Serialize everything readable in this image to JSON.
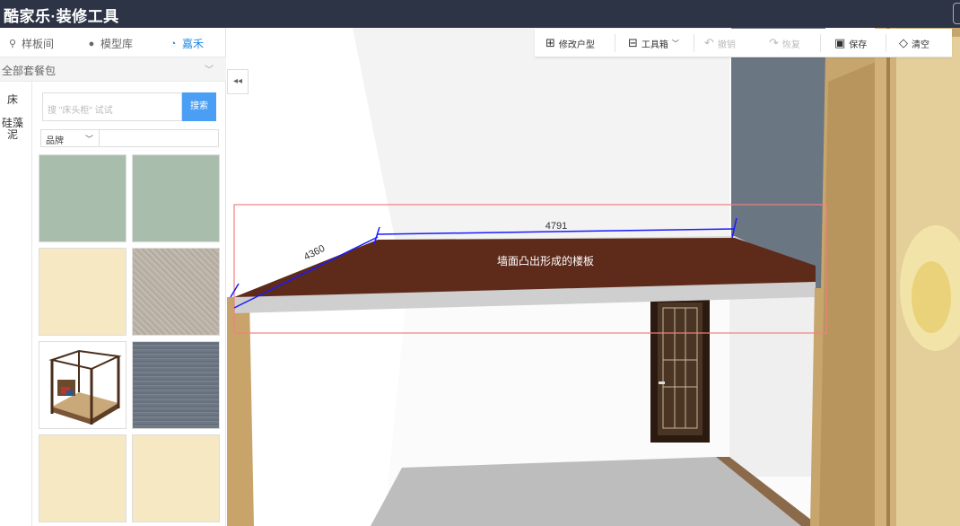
{
  "app": {
    "title": "酷家乐·装修工具"
  },
  "sidebar": {
    "tabs": [
      {
        "label": "样板间",
        "icon": "pin-icon"
      },
      {
        "label": "模型库",
        "icon": "cube-icon"
      },
      {
        "label": "嘉禾",
        "icon": "tag-icon",
        "active": true
      }
    ],
    "package_filter": {
      "value": "全部套餐包"
    },
    "categories": [
      "床",
      "硅藻泥"
    ],
    "search": {
      "placeholder": "搜 \"床头柜\" 试试",
      "button": "搜索"
    },
    "brand_filter": {
      "label": "品牌"
    },
    "products": [
      {
        "kind": "swatch",
        "color": "#a9bdad"
      },
      {
        "kind": "swatch",
        "color": "#a9bdad"
      },
      {
        "kind": "swatch",
        "color": "#f5e8c3"
      },
      {
        "kind": "texture",
        "color": "#b8b0a4"
      },
      {
        "kind": "bed-image"
      },
      {
        "kind": "texture",
        "color": "#6e7784"
      },
      {
        "kind": "swatch",
        "color": "#f5e8c3"
      },
      {
        "kind": "swatch",
        "color": "#f5e8c3"
      }
    ]
  },
  "toolbar": {
    "edit_floorplan": "修改户型",
    "toolbox": "工具箱",
    "undo": "撤销",
    "redo": "恢复",
    "save": "保存",
    "clear": "清空"
  },
  "scene": {
    "dimension_left": "4360",
    "dimension_top": "4791",
    "floor_label": "墙面凸出形成的楼板",
    "colors": {
      "slab": "#5e2a1a",
      "selection": "#f08080",
      "dimension": "#1a1aff",
      "wall_dark": "#6b7683",
      "door": "#2b1a10"
    }
  }
}
